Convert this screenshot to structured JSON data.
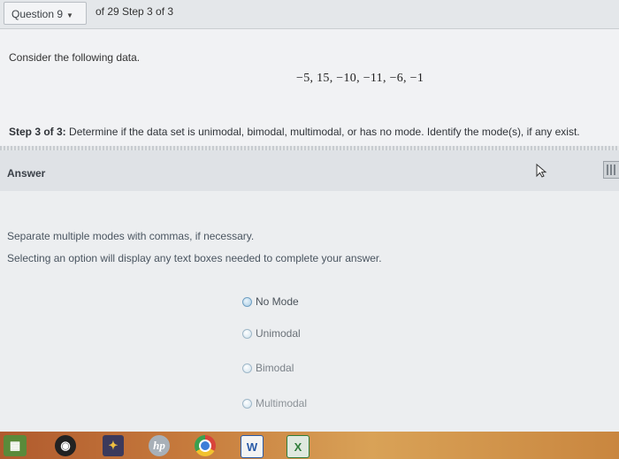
{
  "header": {
    "question_button": "Question 9",
    "progress": "of 29 Step 3 of 3"
  },
  "problem": {
    "prompt": "Consider the following data.",
    "data_values": "−5, 15, −10, −11, −6, −1",
    "step_label": "Step 3 of 3:",
    "step_text": " Determine if the data set is unimodal, bimodal, multimodal, or has no mode. Identify the mode(s), if any exist."
  },
  "answer": {
    "header_label": "Answer",
    "hint_multiple": "Separate multiple modes with commas, if necessary.",
    "hint_select": "Selecting an option will display any text boxes needed to complete your answer.",
    "options": [
      "No Mode",
      "Unimodal",
      "Bimodal",
      "Multimodal"
    ]
  },
  "taskbar": {
    "icons": [
      "windows-start-icon",
      "obs-icon",
      "photos-icon",
      "hp-icon",
      "chrome-icon",
      "word-icon",
      "excel-icon"
    ],
    "word_glyph": "W",
    "excel_glyph": "X",
    "hp_glyph": "hp"
  }
}
